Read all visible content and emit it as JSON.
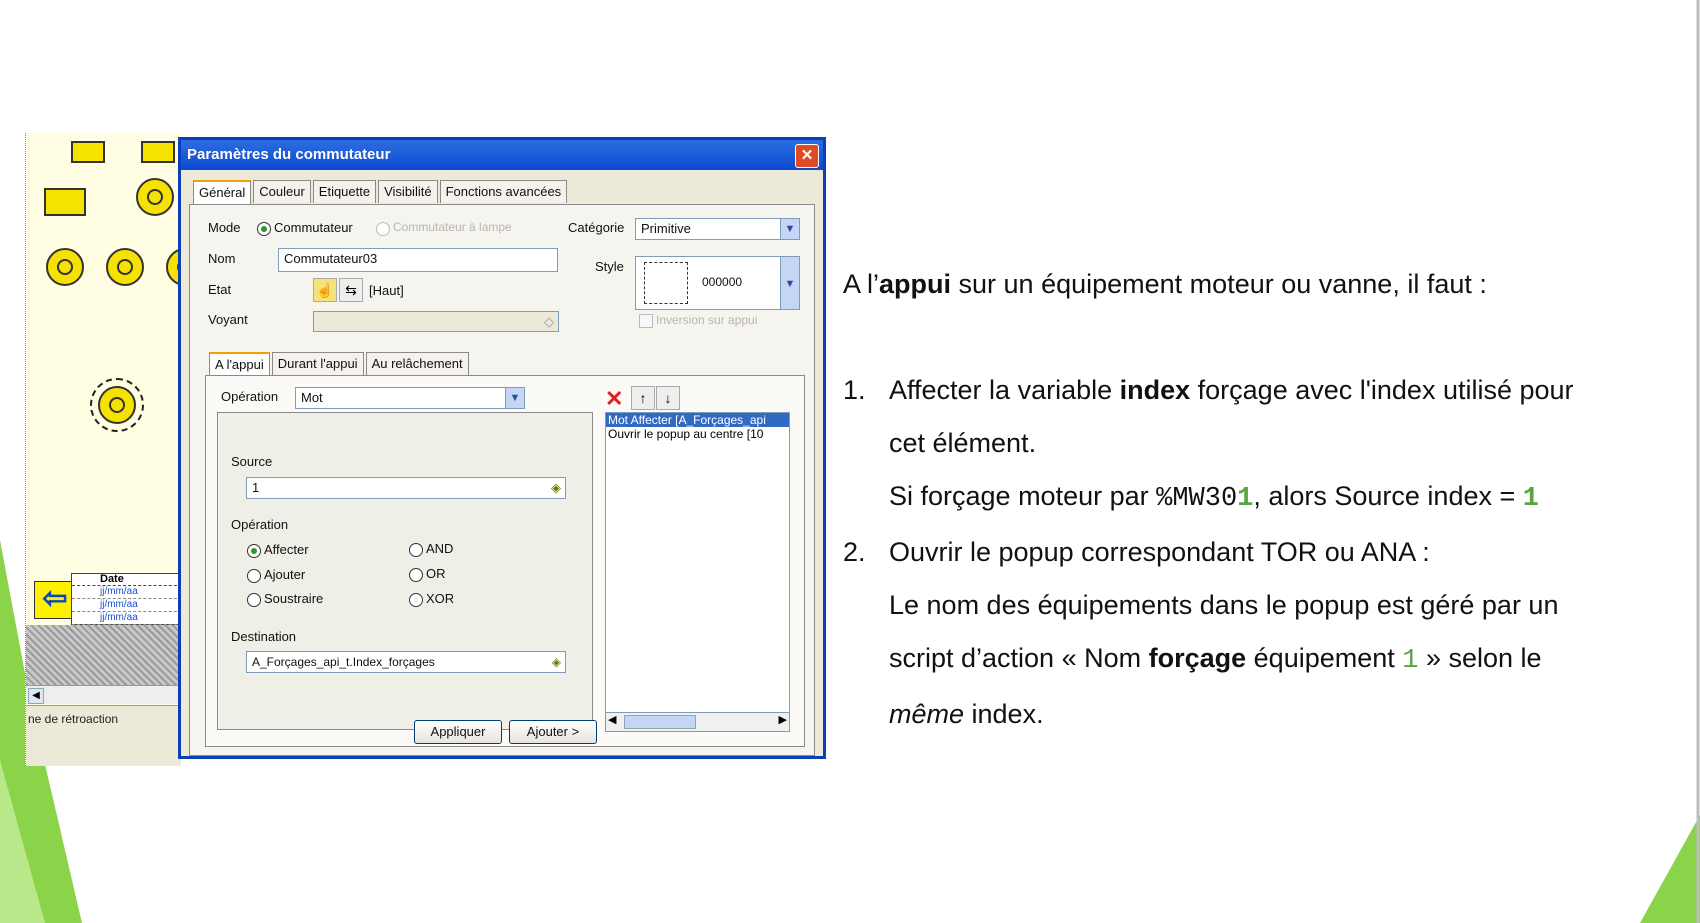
{
  "colors": {
    "accent_green": "#8bd449",
    "dialog_blue": "#0a4bd0",
    "value_green": "#57a640"
  },
  "canvas": {
    "table": {
      "header": "Date",
      "rows": [
        "jj/mm/aa",
        "jj/mm/aa",
        "jj/mm/aa"
      ]
    },
    "status_text": "ne de rétroaction"
  },
  "dialog": {
    "title": "Paramètres du commutateur",
    "tabs": [
      "Général",
      "Couleur",
      "Etiquette",
      "Visibilité",
      "Fonctions avancées"
    ],
    "mode": {
      "label": "Mode",
      "option1": "Commutateur",
      "option2": "Commutateur à lampe"
    },
    "categorie": {
      "label": "Catégorie",
      "value": "Primitive"
    },
    "nom": {
      "label": "Nom",
      "value": "Commutateur03"
    },
    "style": {
      "label": "Style",
      "value": "000000"
    },
    "etat": {
      "label": "Etat",
      "value": "[Haut]"
    },
    "voyant": {
      "label": "Voyant"
    },
    "inversion": "Inversion sur appui",
    "subtabs": [
      "A l'appui",
      "Durant l'appui",
      "Au relâchement"
    ],
    "operation": {
      "label": "Opération",
      "value": "Mot"
    },
    "source": {
      "label": "Source",
      "value": "1"
    },
    "operation_group": {
      "label": "Opération",
      "options": [
        "Affecter",
        "Ajouter",
        "Soustraire",
        "AND",
        "OR",
        "XOR"
      ]
    },
    "destination": {
      "label": "Destination",
      "value": "A_Forçages_api_t.Index_forçages"
    },
    "actions_list": [
      "Mot Affecter [A_Forçages_api",
      "Ouvrir le popup au centre [10"
    ],
    "buttons": {
      "apply": "Appliquer",
      "add": "Ajouter >"
    }
  },
  "content": {
    "intro_pre": "A l’",
    "intro_bold": "appui",
    "intro_post": " sur un équipement moteur ou vanne, il faut :",
    "item1": {
      "number": "1.",
      "line1_pre": "Affecter la variable ",
      "line1_bold": "index",
      "line1_post": " forçage avec l'index utilisé pour",
      "line2": "cet élément.",
      "line3_pre": "Si forçage moteur par ",
      "line3_code": "%MW30",
      "line3_code_green": "1",
      "line3_post": ", alors Source index = ",
      "line3_value": "1"
    },
    "item2": {
      "number": "2.",
      "line1": "Ouvrir le popup correspondant TOR ou ANA :",
      "line2": "Le nom des équipements dans le popup est géré par un",
      "line3_pre": "script d’action « Nom ",
      "line3_bold": "forçage",
      "line3_mid": " équipement ",
      "line3_code": "1",
      "line3_post": " » selon le",
      "line4_italic": "même",
      "line4_post": " index."
    }
  }
}
